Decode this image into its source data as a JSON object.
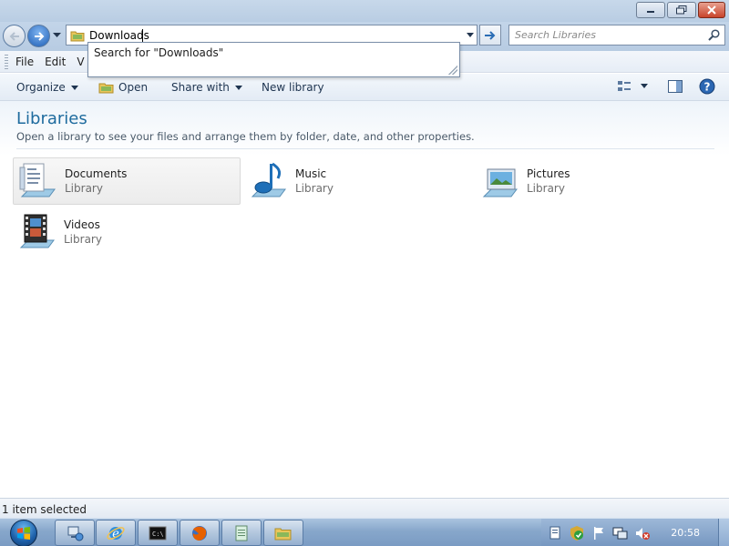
{
  "window": {
    "controls": [
      "minimize",
      "maximize",
      "close"
    ]
  },
  "navigation": {
    "address_value": "Downloads",
    "search_placeholder": "Search Libraries"
  },
  "autocomplete": {
    "suggestion": "Search for \"Downloads\""
  },
  "menu": {
    "items": [
      "File",
      "Edit",
      "V"
    ]
  },
  "commands": {
    "organize": "Organize",
    "open": "Open",
    "share_with": "Share with",
    "new_library": "New library"
  },
  "content": {
    "title": "Libraries",
    "subtitle": "Open a library to see your files and arrange them by folder, date, and other properties.",
    "libraries": [
      {
        "name": "Documents",
        "type": "Library",
        "icon": "documents-library-icon",
        "selected": true
      },
      {
        "name": "Music",
        "type": "Library",
        "icon": "music-library-icon",
        "selected": false
      },
      {
        "name": "Pictures",
        "type": "Library",
        "icon": "pictures-library-icon",
        "selected": false
      },
      {
        "name": "Videos",
        "type": "Library",
        "icon": "videos-library-icon",
        "selected": false
      }
    ]
  },
  "status": {
    "text": "1 item selected"
  },
  "taskbar": {
    "clock": "20:58",
    "apps": [
      "network-app-icon",
      "internet-explorer-icon",
      "command-prompt-icon",
      "firefox-icon",
      "notepad-icon",
      "explorer-icon"
    ],
    "tray": [
      "document-tray-icon",
      "security-shield-icon",
      "flag-icon",
      "network-tray-icon",
      "volume-muted-icon"
    ]
  },
  "colors": {
    "title_accent": "#1e6b9e",
    "taskbar": "#87a7cb",
    "close_button": "#c8432b"
  }
}
